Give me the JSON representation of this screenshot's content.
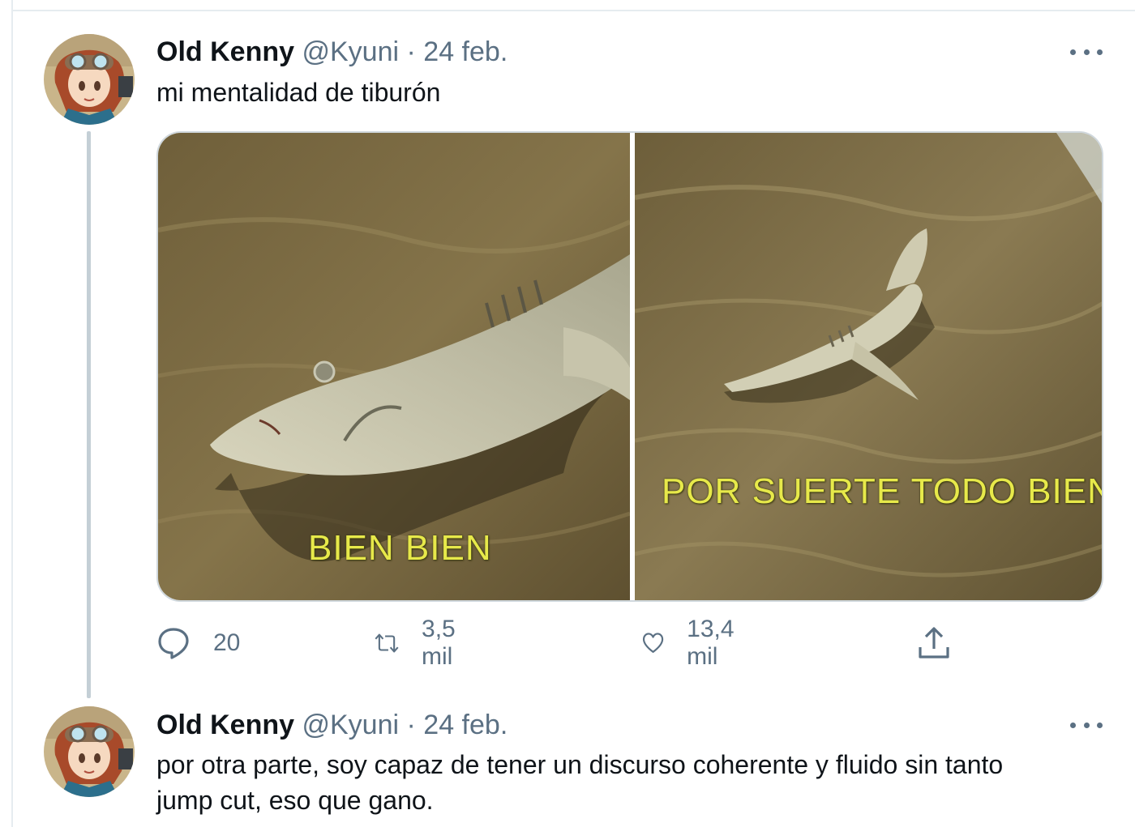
{
  "tweets": [
    {
      "name": "Old Kenny",
      "handle": "@Kyuni",
      "separator": "·",
      "date": "24 feb.",
      "text": "mi mentalidad de tiburón",
      "media": {
        "left_caption": "BIEN BIEN",
        "right_caption": "POR SUERTE TODO BIEN"
      },
      "actions": {
        "replies": "20",
        "retweets": "3,5 mil",
        "likes": "13,4 mil"
      }
    },
    {
      "name": "Old Kenny",
      "handle": "@Kyuni",
      "separator": "·",
      "date": "24 feb.",
      "text": "por otra parte, soy capaz de tener un discurso coherente y fluido sin tanto jump cut, eso que gano."
    }
  ],
  "icons": {
    "reply": "comment-bubble-icon",
    "retweet": "retweet-arrows-icon",
    "like": "heart-icon",
    "share": "share-upload-icon",
    "more": "more-dots-icon"
  },
  "colors": {
    "text": "#0f1419",
    "secondary": "#5b7083",
    "caption": "#e7e94a",
    "thread_line": "#c4cfd6"
  }
}
